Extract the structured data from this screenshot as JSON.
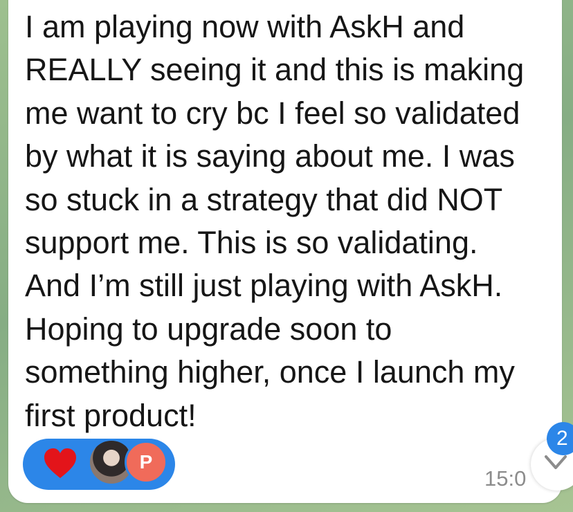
{
  "message": {
    "text": "I am playing now with AskH and\nREALLY seeing it and this is making\nme want to cry bc I feel so validated\nby what it is saying about me. I was\nso stuck in a strategy that did NOT\nsupport me. This is so validating.\nAnd I’m still just playing with AskH.\nHoping to upgrade soon to\nsomething higher, once I launch my\nfirst product!",
    "time": "15:0"
  },
  "reaction": {
    "emoji_icon": "red-heart-icon",
    "reactor_initial": "P",
    "colors": {
      "pill": "#2c86e8",
      "heart": "#e3141a",
      "initial_avatar": "#f06b5a"
    }
  },
  "scroll_down": {
    "unread_count": "2",
    "icon": "chevron-down-icon"
  }
}
